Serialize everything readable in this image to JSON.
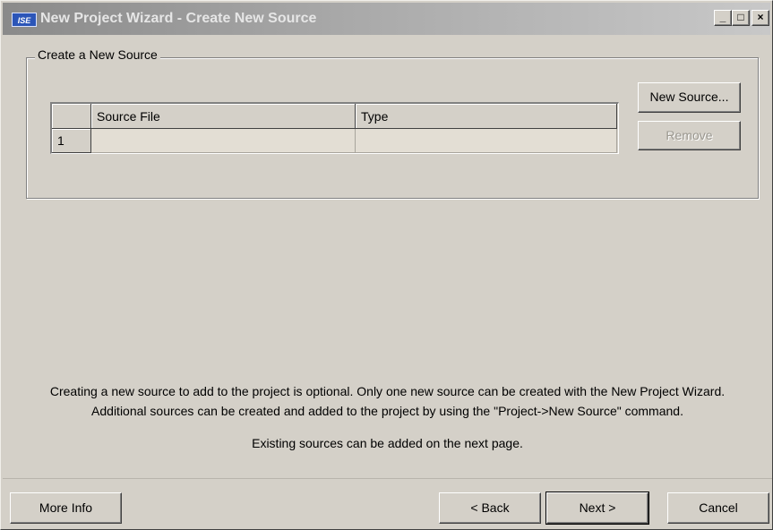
{
  "window": {
    "title": "New Project Wizard - Create New Source",
    "icon_text": "ISE",
    "minimize": "_",
    "maximize": "□",
    "close": "×"
  },
  "group": {
    "label": "Create a New Source"
  },
  "grid": {
    "columns": [
      "Source File",
      "Type"
    ],
    "rows": [
      {
        "num": "1",
        "source_file": "",
        "type": ""
      }
    ]
  },
  "buttons": {
    "new_source": "New Source...",
    "remove": "Remove",
    "more_info": "More Info",
    "back": "< Back",
    "next": "Next >",
    "cancel": "Cancel"
  },
  "info": {
    "line1": "Creating a new source to add to the project is optional. Only one new source can be created with the New Project Wizard.",
    "line2": "Additional sources can be created and added to the project by using the \"Project->New Source\" command.",
    "line3": "Existing sources can be added on the next page."
  },
  "colors": {
    "face": "#d4d0c8",
    "title_gradient_start": "#8a8a8a",
    "title_gradient_end": "#c8c8c8",
    "cell_bg": "#e3ded4"
  }
}
